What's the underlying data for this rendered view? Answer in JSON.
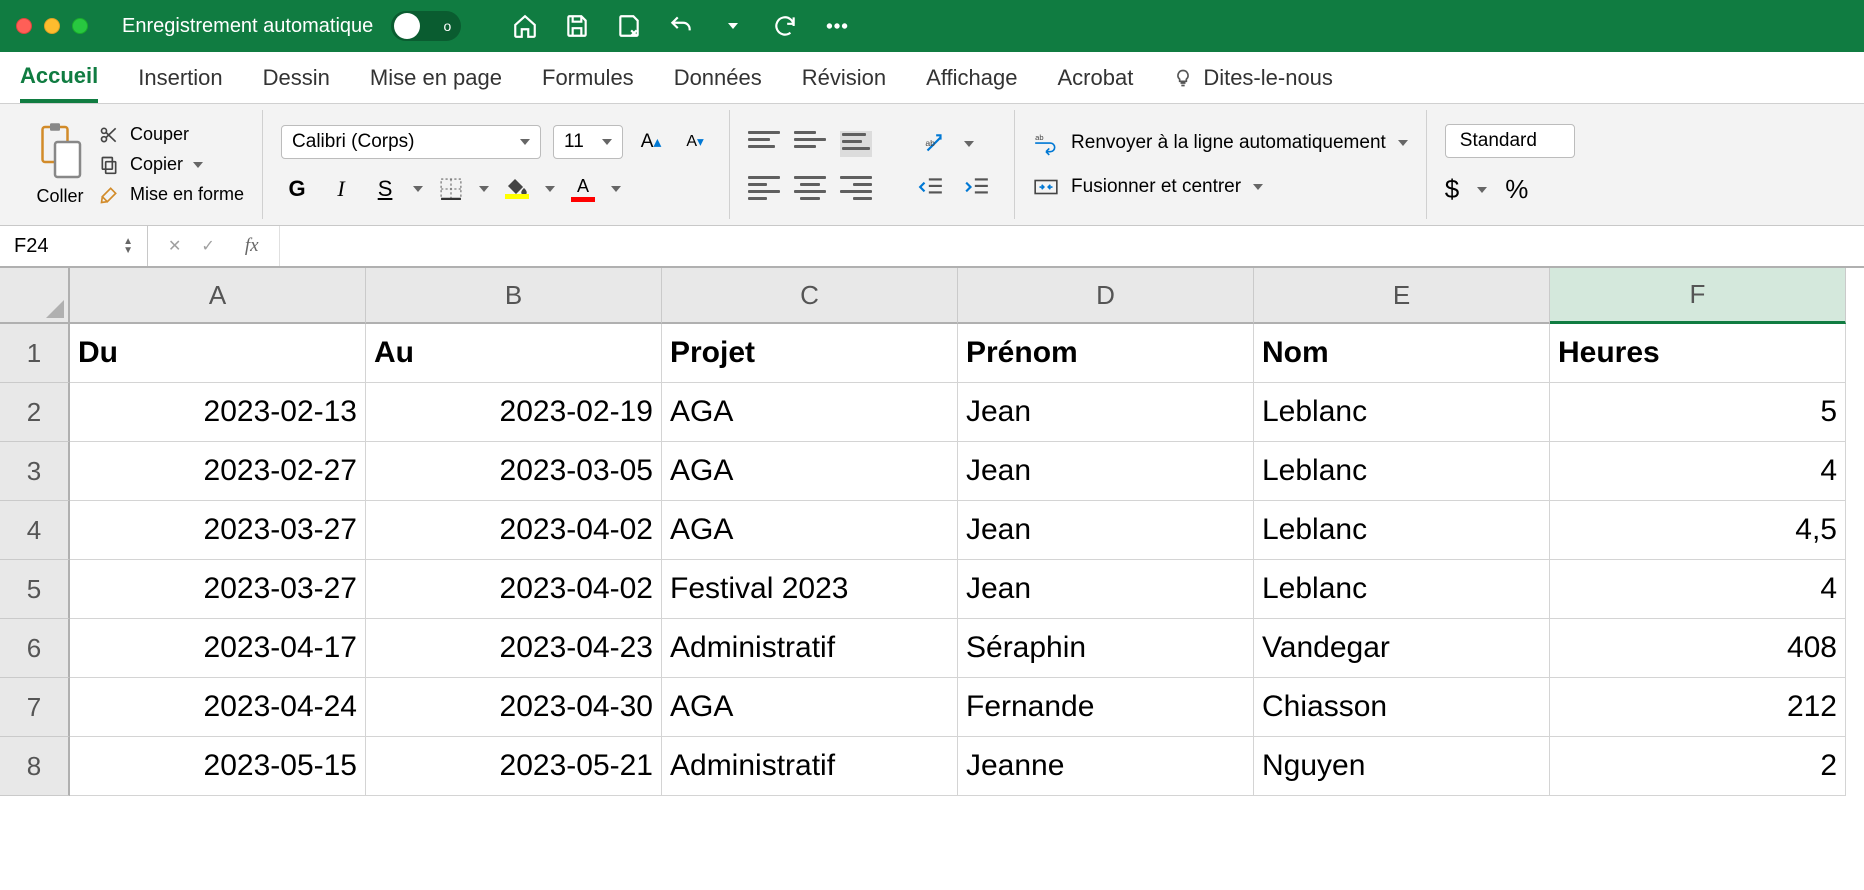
{
  "titlebar": {
    "autosave_label": "Enregistrement automatique",
    "autosave_state": "o"
  },
  "tabs": {
    "accueil": "Accueil",
    "insertion": "Insertion",
    "dessin": "Dessin",
    "mise_en_page": "Mise en page",
    "formules": "Formules",
    "donnees": "Données",
    "revision": "Révision",
    "affichage": "Affichage",
    "acrobat": "Acrobat",
    "tellme": "Dites-le-nous"
  },
  "ribbon": {
    "paste": "Coller",
    "cut": "Couper",
    "copy": "Copier",
    "format_painter": "Mise en forme",
    "font_name": "Calibri (Corps)",
    "font_size": "11",
    "bold": "G",
    "italic": "I",
    "underline": "S",
    "wrap": "Renvoyer à la ligne automatiquement",
    "merge": "Fusionner et centrer",
    "number_format": "Standard",
    "currency": "$",
    "percent": "%"
  },
  "fbar": {
    "name": "F24",
    "fx": "fx",
    "value": ""
  },
  "columns": [
    "A",
    "B",
    "C",
    "D",
    "E",
    "F"
  ],
  "rows": [
    "1",
    "2",
    "3",
    "4",
    "5",
    "6",
    "7",
    "8"
  ],
  "headers": {
    "du": "Du",
    "au": "Au",
    "projet": "Projet",
    "prenom": "Prénom",
    "nom": "Nom",
    "heures": "Heures"
  },
  "data": [
    {
      "du": "2023-02-13",
      "au": "2023-02-19",
      "projet": "AGA",
      "prenom": "Jean",
      "nom": "Leblanc",
      "heures": "5"
    },
    {
      "du": "2023-02-27",
      "au": "2023-03-05",
      "projet": "AGA",
      "prenom": "Jean",
      "nom": "Leblanc",
      "heures": "4"
    },
    {
      "du": "2023-03-27",
      "au": "2023-04-02",
      "projet": "AGA",
      "prenom": "Jean",
      "nom": "Leblanc",
      "heures": "4,5"
    },
    {
      "du": "2023-03-27",
      "au": "2023-04-02",
      "projet": "Festival 2023",
      "prenom": "Jean",
      "nom": "Leblanc",
      "heures": "4"
    },
    {
      "du": "2023-04-17",
      "au": "2023-04-23",
      "projet": "Administratif",
      "prenom": "Séraphin",
      "nom": "Vandegar",
      "heures": "408"
    },
    {
      "du": "2023-04-24",
      "au": "2023-04-30",
      "projet": "AGA",
      "prenom": "Fernande",
      "nom": "Chiasson",
      "heures": "212"
    },
    {
      "du": "2023-05-15",
      "au": "2023-05-21",
      "projet": "Administratif",
      "prenom": "Jeanne",
      "nom": "Nguyen",
      "heures": "2"
    }
  ]
}
